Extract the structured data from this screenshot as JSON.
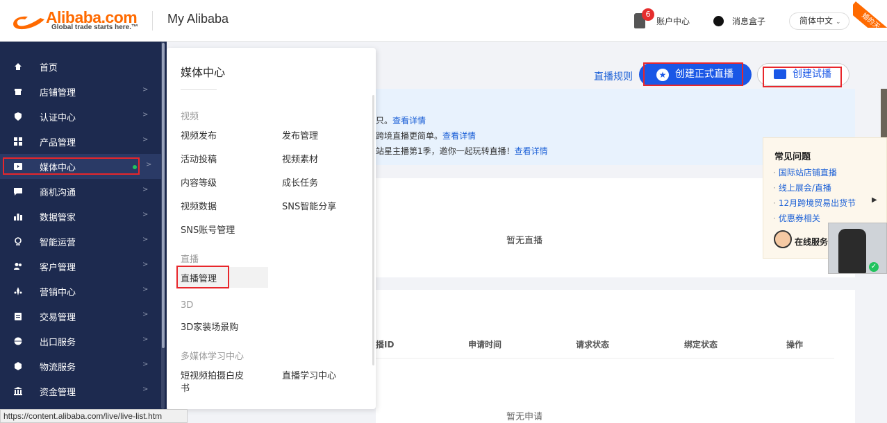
{
  "header": {
    "brand": "Alibaba.com",
    "slogan": "Global trade starts here.™",
    "product": "My Alibaba",
    "account_badge": "6",
    "account_label": "账户中心",
    "message_label": "消息盒子",
    "language": "简体中文",
    "ribbon": "婚的天"
  },
  "sidebar": {
    "items": [
      {
        "label": "首页",
        "icon": "home-icon"
      },
      {
        "label": "店铺管理",
        "icon": "store-icon"
      },
      {
        "label": "认证中心",
        "icon": "shield-icon"
      },
      {
        "label": "产品管理",
        "icon": "grid-icon"
      },
      {
        "label": "媒体中心",
        "icon": "media-icon"
      },
      {
        "label": "商机沟通",
        "icon": "chat-icon"
      },
      {
        "label": "数据管家",
        "icon": "bar-chart-icon"
      },
      {
        "label": "智能运营",
        "icon": "location-icon"
      },
      {
        "label": "客户管理",
        "icon": "users-icon"
      },
      {
        "label": "营销中心",
        "icon": "marketing-icon"
      },
      {
        "label": "交易管理",
        "icon": "clipboard-icon"
      },
      {
        "label": "出口服务",
        "icon": "globe-icon"
      },
      {
        "label": "物流服务",
        "icon": "truck-icon"
      },
      {
        "label": "资金管理",
        "icon": "bank-icon"
      }
    ],
    "arrow": ">"
  },
  "flyout": {
    "title": "媒体中心",
    "sections": {
      "video": {
        "title": "视频",
        "links": [
          "视频发布",
          "发布管理",
          "活动投稿",
          "视频素材",
          "内容等级",
          "成长任务",
          "视频数据",
          "SNS智能分享",
          "SNS账号管理"
        ]
      },
      "live": {
        "title": "直播",
        "links": [
          "直播管理"
        ]
      },
      "threed": {
        "title": "3D",
        "links": [
          "3D家装场景购"
        ]
      },
      "learning": {
        "title": "多媒体学习中心",
        "links": [
          "短视频拍摄白皮",
          "书",
          "直播学习中心"
        ]
      }
    }
  },
  "main": {
    "rule_link": "直播规则",
    "create_formal": "创建正式直播",
    "create_trial": "创建试播",
    "info_lines": [
      {
        "text": "只。",
        "link": "查看详情"
      },
      {
        "text": "跨境直播更简单。",
        "link": "查看详情"
      },
      {
        "text": "站星主播第1季，邀你一起玩转直播！",
        "link": "查看详情"
      }
    ],
    "empty_live": "暂无直播",
    "table_headers": [
      "播ID",
      "申请时间",
      "请求状态",
      "绑定状态",
      "操作"
    ],
    "empty_request": "暂无申请"
  },
  "faq": {
    "title": "常见问题",
    "items": [
      "国际站店铺直播",
      "线上展会/直播",
      "12月跨境贸易出货节",
      "优惠券相关"
    ],
    "online": "在线服务"
  },
  "statusbar": "https://content.alibaba.com/live/live-list.htm",
  "colors": {
    "sidebar": "#1d2a4f",
    "accent": "#1a57e6",
    "brand": "#ff6a00",
    "highlight": "#e8262b"
  }
}
